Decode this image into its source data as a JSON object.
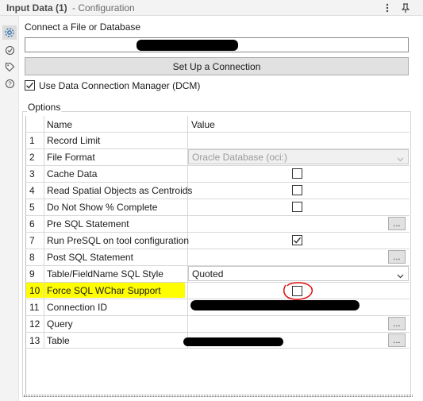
{
  "window": {
    "title": "Input Data (1)",
    "subtitle": "- Configuration",
    "more_icon": "more-vertical-icon",
    "pin_icon": "pin-icon"
  },
  "rail": {
    "items": [
      {
        "icon": "gear-icon",
        "active": true
      },
      {
        "icon": "refresh-icon",
        "active": false
      },
      {
        "icon": "tag-icon",
        "active": false
      },
      {
        "icon": "help-icon",
        "active": false
      }
    ]
  },
  "connection": {
    "label": "Connect a File or Database",
    "value": "",
    "setup_button": "Set Up a Connection",
    "dcm_label": "Use Data Connection Manager (DCM)",
    "dcm_checked": true
  },
  "options": {
    "group_label": "Options",
    "headers": {
      "name": "Name",
      "value": "Value"
    },
    "rows": [
      {
        "num": "1",
        "name": "Record Limit",
        "type": "text",
        "value": ""
      },
      {
        "num": "2",
        "name": "File Format",
        "type": "combo-disabled",
        "value": "Oracle Database (oci:)"
      },
      {
        "num": "3",
        "name": "Cache Data",
        "type": "checkbox",
        "checked": false
      },
      {
        "num": "4",
        "name": "Read Spatial Objects as Centroids",
        "type": "checkbox",
        "checked": false
      },
      {
        "num": "5",
        "name": "Do Not Show % Complete",
        "type": "checkbox",
        "checked": false
      },
      {
        "num": "6",
        "name": "Pre SQL Statement",
        "type": "ellipsis",
        "button": "..."
      },
      {
        "num": "7",
        "name": "Run PreSQL on tool configuration",
        "type": "checkbox",
        "checked": true
      },
      {
        "num": "8",
        "name": "Post SQL Statement",
        "type": "ellipsis",
        "button": "..."
      },
      {
        "num": "9",
        "name": "Table/FieldName SQL Style",
        "type": "combo",
        "value": "Quoted"
      },
      {
        "num": "10",
        "name": "Force SQL WChar Support",
        "type": "checkbox",
        "checked": false,
        "highlighted": true
      },
      {
        "num": "11",
        "name": "Connection ID",
        "type": "redacted"
      },
      {
        "num": "12",
        "name": "Query",
        "type": "ellipsis",
        "button": "..."
      },
      {
        "num": "13",
        "name": "Table",
        "type": "ellipsis-redacted",
        "button": "..."
      }
    ]
  },
  "colors": {
    "highlight": "#fffe00",
    "annotation_circle": "#e01010",
    "panel_bg": "#f3f3f3"
  }
}
